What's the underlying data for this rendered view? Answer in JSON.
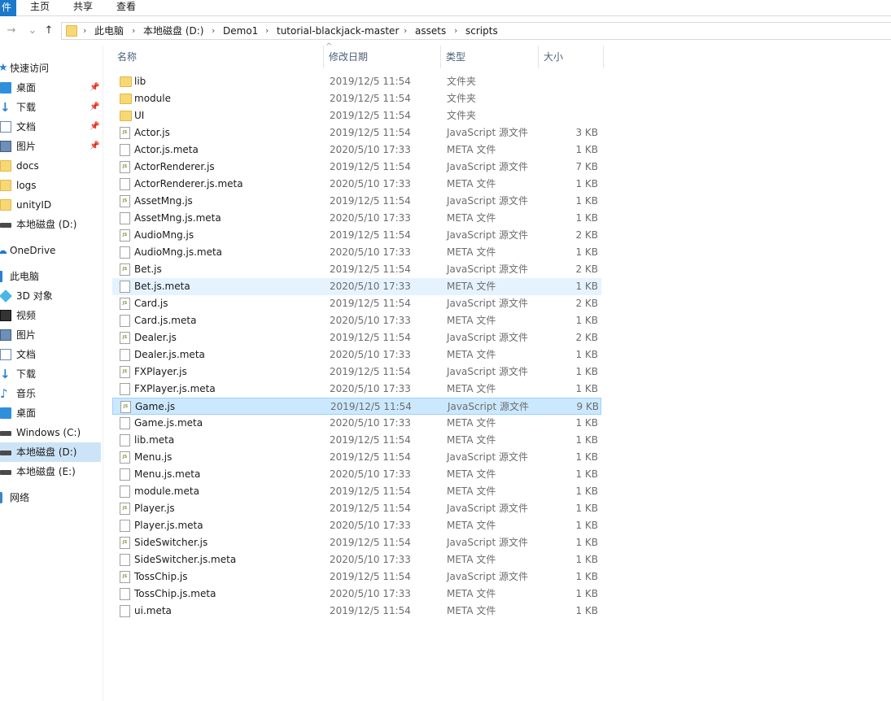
{
  "ribbon": {
    "file_tab": "件",
    "tabs": [
      "主页",
      "共享",
      "查看"
    ]
  },
  "address": {
    "crumbs": [
      "此电脑",
      "本地磁盘 (D:)",
      "Demo1",
      "tutorial-blackjack-master",
      "assets",
      "scripts"
    ]
  },
  "nav": {
    "back_icon": "→",
    "recent_icon": "⌄",
    "up_icon": "↑",
    "items": [
      {
        "label": "快速访问",
        "icon": "star"
      },
      {
        "label": "桌面",
        "icon": "desktop",
        "pinned": true
      },
      {
        "label": "下载",
        "icon": "arrow",
        "pinned": true
      },
      {
        "label": "文档",
        "icon": "doc",
        "pinned": true
      },
      {
        "label": "图片",
        "icon": "pic",
        "pinned": true
      },
      {
        "label": "docs",
        "icon": "folder"
      },
      {
        "label": "logs",
        "icon": "folder"
      },
      {
        "label": "unityID",
        "icon": "folder"
      },
      {
        "label": "本地磁盘 (D:)",
        "icon": "drive"
      },
      {
        "label": "OneDrive",
        "icon": "cloud"
      },
      {
        "label": "此电脑",
        "icon": "pc"
      },
      {
        "label": "3D 对象",
        "icon": "obj3d"
      },
      {
        "label": "视频",
        "icon": "video"
      },
      {
        "label": "图片",
        "icon": "pic"
      },
      {
        "label": "文档",
        "icon": "doc"
      },
      {
        "label": "下载",
        "icon": "arrow"
      },
      {
        "label": "音乐",
        "icon": "music"
      },
      {
        "label": "桌面",
        "icon": "desktop"
      },
      {
        "label": "Windows (C:)",
        "icon": "drive"
      },
      {
        "label": "本地磁盘 (D:)",
        "icon": "drive",
        "selected": true
      },
      {
        "label": "本地磁盘 (E:)",
        "icon": "drive"
      },
      {
        "label": "网络",
        "icon": "net"
      }
    ]
  },
  "columns": {
    "name": "名称",
    "date": "修改日期",
    "type": "类型",
    "size": "大小",
    "sort_indicator": "^"
  },
  "files": [
    {
      "name": "lib",
      "date": "2019/12/5 11:54",
      "type": "文件夹",
      "size": "",
      "kind": "folder"
    },
    {
      "name": "module",
      "date": "2019/12/5 11:54",
      "type": "文件夹",
      "size": "",
      "kind": "folder"
    },
    {
      "name": "UI",
      "date": "2019/12/5 11:54",
      "type": "文件夹",
      "size": "",
      "kind": "folder"
    },
    {
      "name": "Actor.js",
      "date": "2019/12/5 11:54",
      "type": "JavaScript 源文件",
      "size": "3 KB",
      "kind": "js"
    },
    {
      "name": "Actor.js.meta",
      "date": "2020/5/10 17:33",
      "type": "META 文件",
      "size": "1 KB",
      "kind": "meta"
    },
    {
      "name": "ActorRenderer.js",
      "date": "2019/12/5 11:54",
      "type": "JavaScript 源文件",
      "size": "7 KB",
      "kind": "js"
    },
    {
      "name": "ActorRenderer.js.meta",
      "date": "2020/5/10 17:33",
      "type": "META 文件",
      "size": "1 KB",
      "kind": "meta"
    },
    {
      "name": "AssetMng.js",
      "date": "2019/12/5 11:54",
      "type": "JavaScript 源文件",
      "size": "1 KB",
      "kind": "js"
    },
    {
      "name": "AssetMng.js.meta",
      "date": "2020/5/10 17:33",
      "type": "META 文件",
      "size": "1 KB",
      "kind": "meta"
    },
    {
      "name": "AudioMng.js",
      "date": "2019/12/5 11:54",
      "type": "JavaScript 源文件",
      "size": "2 KB",
      "kind": "js"
    },
    {
      "name": "AudioMng.js.meta",
      "date": "2020/5/10 17:33",
      "type": "META 文件",
      "size": "1 KB",
      "kind": "meta"
    },
    {
      "name": "Bet.js",
      "date": "2019/12/5 11:54",
      "type": "JavaScript 源文件",
      "size": "2 KB",
      "kind": "js"
    },
    {
      "name": "Bet.js.meta",
      "date": "2020/5/10 17:33",
      "type": "META 文件",
      "size": "1 KB",
      "kind": "meta",
      "state": "hover"
    },
    {
      "name": "Card.js",
      "date": "2019/12/5 11:54",
      "type": "JavaScript 源文件",
      "size": "2 KB",
      "kind": "js"
    },
    {
      "name": "Card.js.meta",
      "date": "2020/5/10 17:33",
      "type": "META 文件",
      "size": "1 KB",
      "kind": "meta"
    },
    {
      "name": "Dealer.js",
      "date": "2019/12/5 11:54",
      "type": "JavaScript 源文件",
      "size": "2 KB",
      "kind": "js"
    },
    {
      "name": "Dealer.js.meta",
      "date": "2020/5/10 17:33",
      "type": "META 文件",
      "size": "1 KB",
      "kind": "meta"
    },
    {
      "name": "FXPlayer.js",
      "date": "2019/12/5 11:54",
      "type": "JavaScript 源文件",
      "size": "1 KB",
      "kind": "js"
    },
    {
      "name": "FXPlayer.js.meta",
      "date": "2020/5/10 17:33",
      "type": "META 文件",
      "size": "1 KB",
      "kind": "meta"
    },
    {
      "name": "Game.js",
      "date": "2019/12/5 11:54",
      "type": "JavaScript 源文件",
      "size": "9 KB",
      "kind": "js",
      "state": "selected"
    },
    {
      "name": "Game.js.meta",
      "date": "2020/5/10 17:33",
      "type": "META 文件",
      "size": "1 KB",
      "kind": "meta"
    },
    {
      "name": "lib.meta",
      "date": "2019/12/5 11:54",
      "type": "META 文件",
      "size": "1 KB",
      "kind": "meta"
    },
    {
      "name": "Menu.js",
      "date": "2019/12/5 11:54",
      "type": "JavaScript 源文件",
      "size": "1 KB",
      "kind": "js"
    },
    {
      "name": "Menu.js.meta",
      "date": "2020/5/10 17:33",
      "type": "META 文件",
      "size": "1 KB",
      "kind": "meta"
    },
    {
      "name": "module.meta",
      "date": "2019/12/5 11:54",
      "type": "META 文件",
      "size": "1 KB",
      "kind": "meta"
    },
    {
      "name": "Player.js",
      "date": "2019/12/5 11:54",
      "type": "JavaScript 源文件",
      "size": "1 KB",
      "kind": "js"
    },
    {
      "name": "Player.js.meta",
      "date": "2020/5/10 17:33",
      "type": "META 文件",
      "size": "1 KB",
      "kind": "meta"
    },
    {
      "name": "SideSwitcher.js",
      "date": "2019/12/5 11:54",
      "type": "JavaScript 源文件",
      "size": "1 KB",
      "kind": "js"
    },
    {
      "name": "SideSwitcher.js.meta",
      "date": "2020/5/10 17:33",
      "type": "META 文件",
      "size": "1 KB",
      "kind": "meta"
    },
    {
      "name": "TossChip.js",
      "date": "2019/12/5 11:54",
      "type": "JavaScript 源文件",
      "size": "1 KB",
      "kind": "js"
    },
    {
      "name": "TossChip.js.meta",
      "date": "2020/5/10 17:33",
      "type": "META 文件",
      "size": "1 KB",
      "kind": "meta"
    },
    {
      "name": "ui.meta",
      "date": "2019/12/5 11:54",
      "type": "META 文件",
      "size": "1 KB",
      "kind": "meta"
    }
  ]
}
